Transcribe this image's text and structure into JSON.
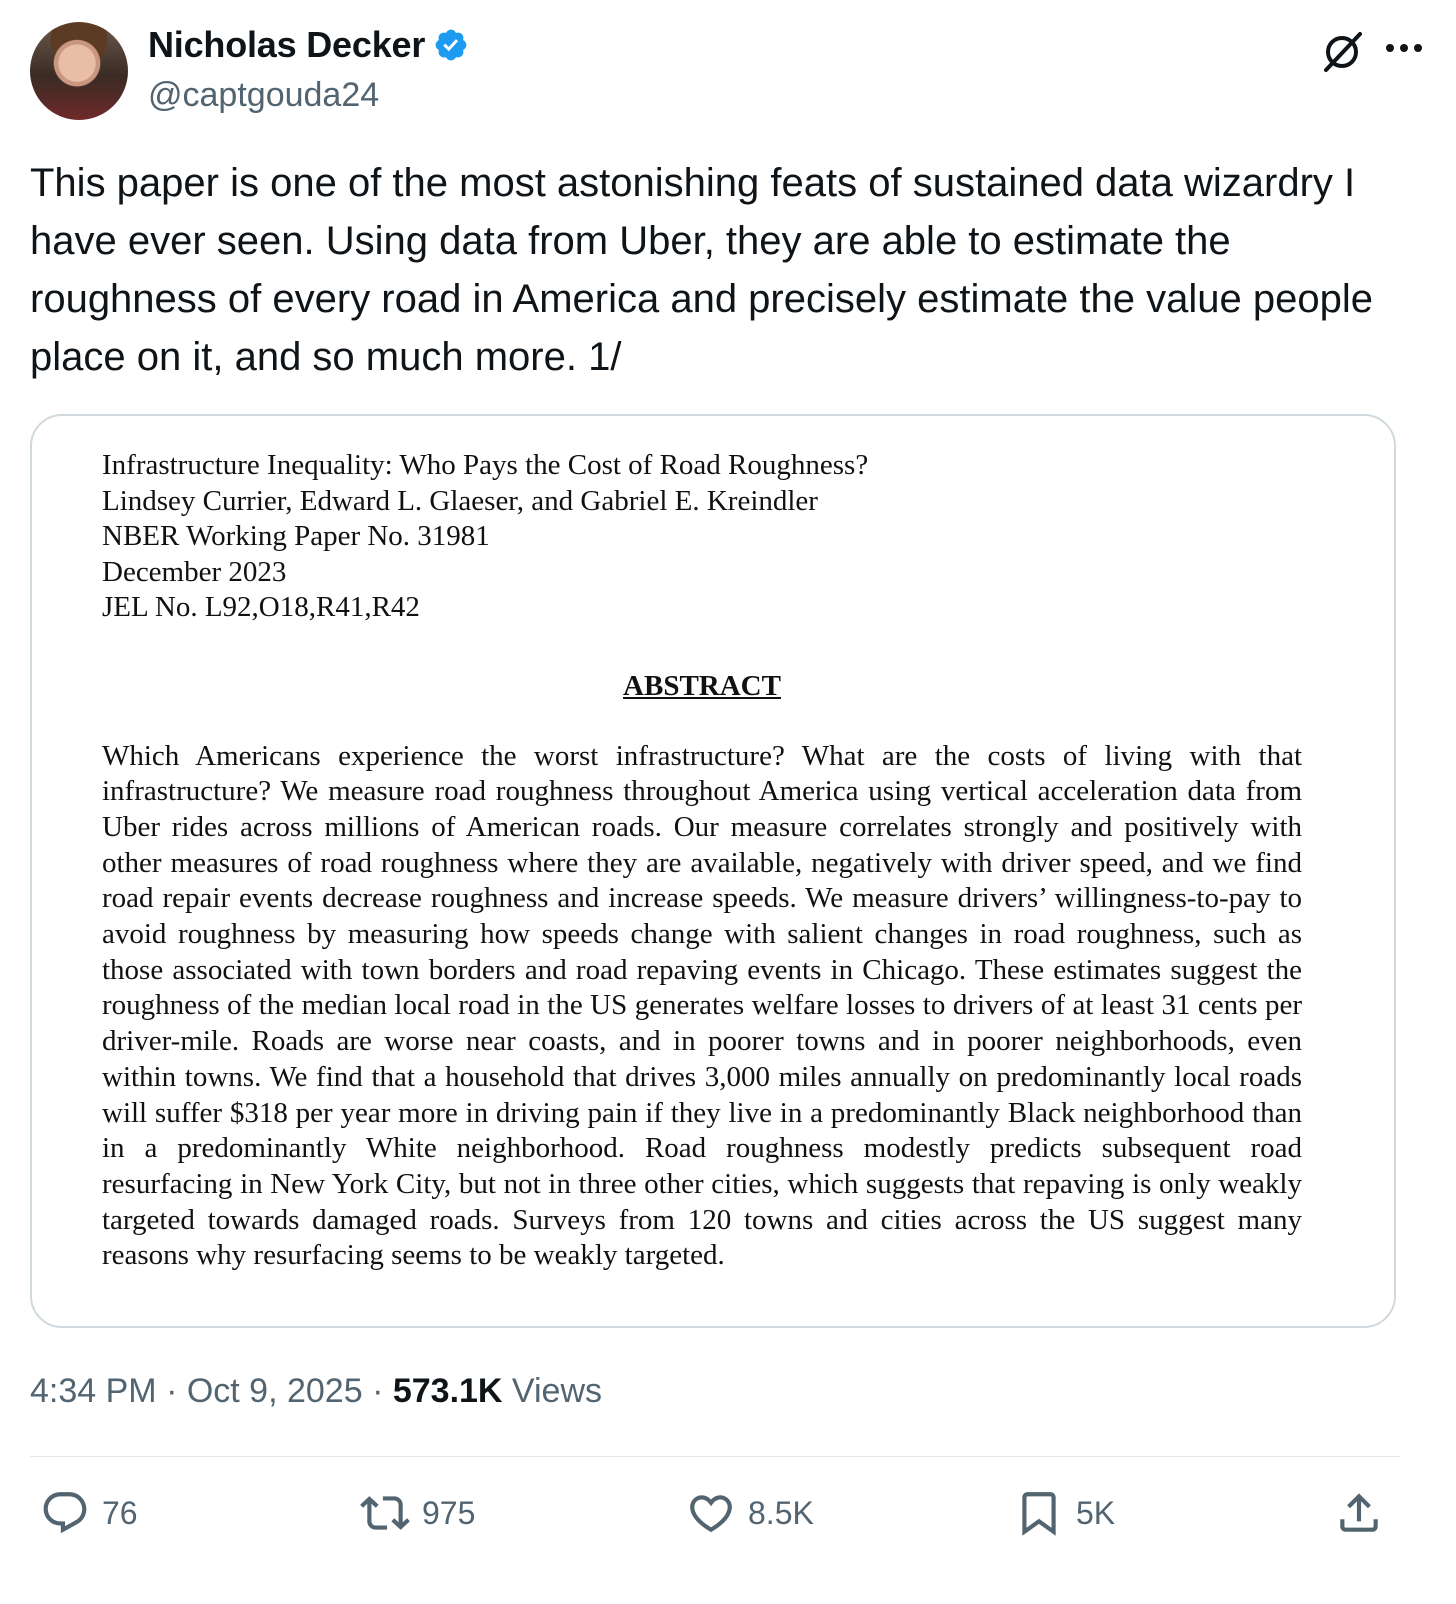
{
  "author": {
    "name": "Nicholas Decker",
    "handle": "@captgouda24",
    "verified": true,
    "verified_color": "#1d9bf0"
  },
  "icons": {
    "verified": "verified-badge-icon",
    "grok": "grok-icon",
    "more": "more-icon",
    "reply": "reply-icon",
    "retweet": "retweet-icon",
    "like": "heart-icon",
    "bookmark": "bookmark-icon",
    "share": "share-icon"
  },
  "tweet": {
    "text": "This paper is one of the most astonishing feats of sustained data wizardry I have ever seen. Using data from Uber, they are able to estimate the roughness of every road in America and precisely estimate the value people place on it, and so much more. 1/"
  },
  "paper": {
    "title": "Infrastructure Inequality: Who Pays the Cost of Road Roughness?",
    "authors": "Lindsey Currier, Edward L. Glaeser, and Gabriel E. Kreindler",
    "series": "NBER Working Paper No. 31981",
    "date": "December 2023",
    "jel": "JEL No. L92,O18,R41,R42",
    "abstract_heading": "ABSTRACT",
    "abstract": "Which Americans experience the worst infrastructure? What are the costs of living with that infrastructure? We measure road roughness throughout America using vertical acceleration data from Uber rides across millions of American roads. Our measure correlates strongly and positively with other measures of road roughness where they are available, negatively with driver speed, and we find road repair events decrease roughness and increase speeds. We measure drivers’ willingness-to-pay to avoid roughness by measuring how speeds change with salient changes in road roughness, such as those associated with town borders and road repaving events in Chicago.  These estimates suggest the roughness of the median local road in the US generates welfare losses to drivers of at least 31 cents per driver-mile. Roads are worse near coasts, and in poorer towns and in poorer neighborhoods, even within towns. We find that a household that drives 3,000 miles annually on predominantly local roads will suffer $318 per year more in driving pain if they live in a predominantly Black neighborhood than in a predominantly White neighborhood. Road roughness modestly predicts subsequent road resurfacing in New York City, but not in three other cities, which suggests that repaving is only weakly targeted towards damaged roads. Surveys from 120 towns and cities across the US suggest many reasons why resurfacing seems to be weakly targeted."
  },
  "meta": {
    "time": "4:34 PM",
    "sep1": " · ",
    "date": "Oct 9, 2025",
    "sep2": " · ",
    "views_count": "573.1K",
    "views_label": " Views"
  },
  "stats": {
    "replies": "76",
    "retweets": "975",
    "likes": "8.5K",
    "bookmarks": "5K"
  },
  "colors": {
    "text_primary": "#0f1419",
    "text_secondary": "#536471",
    "border": "#cfd9de"
  }
}
